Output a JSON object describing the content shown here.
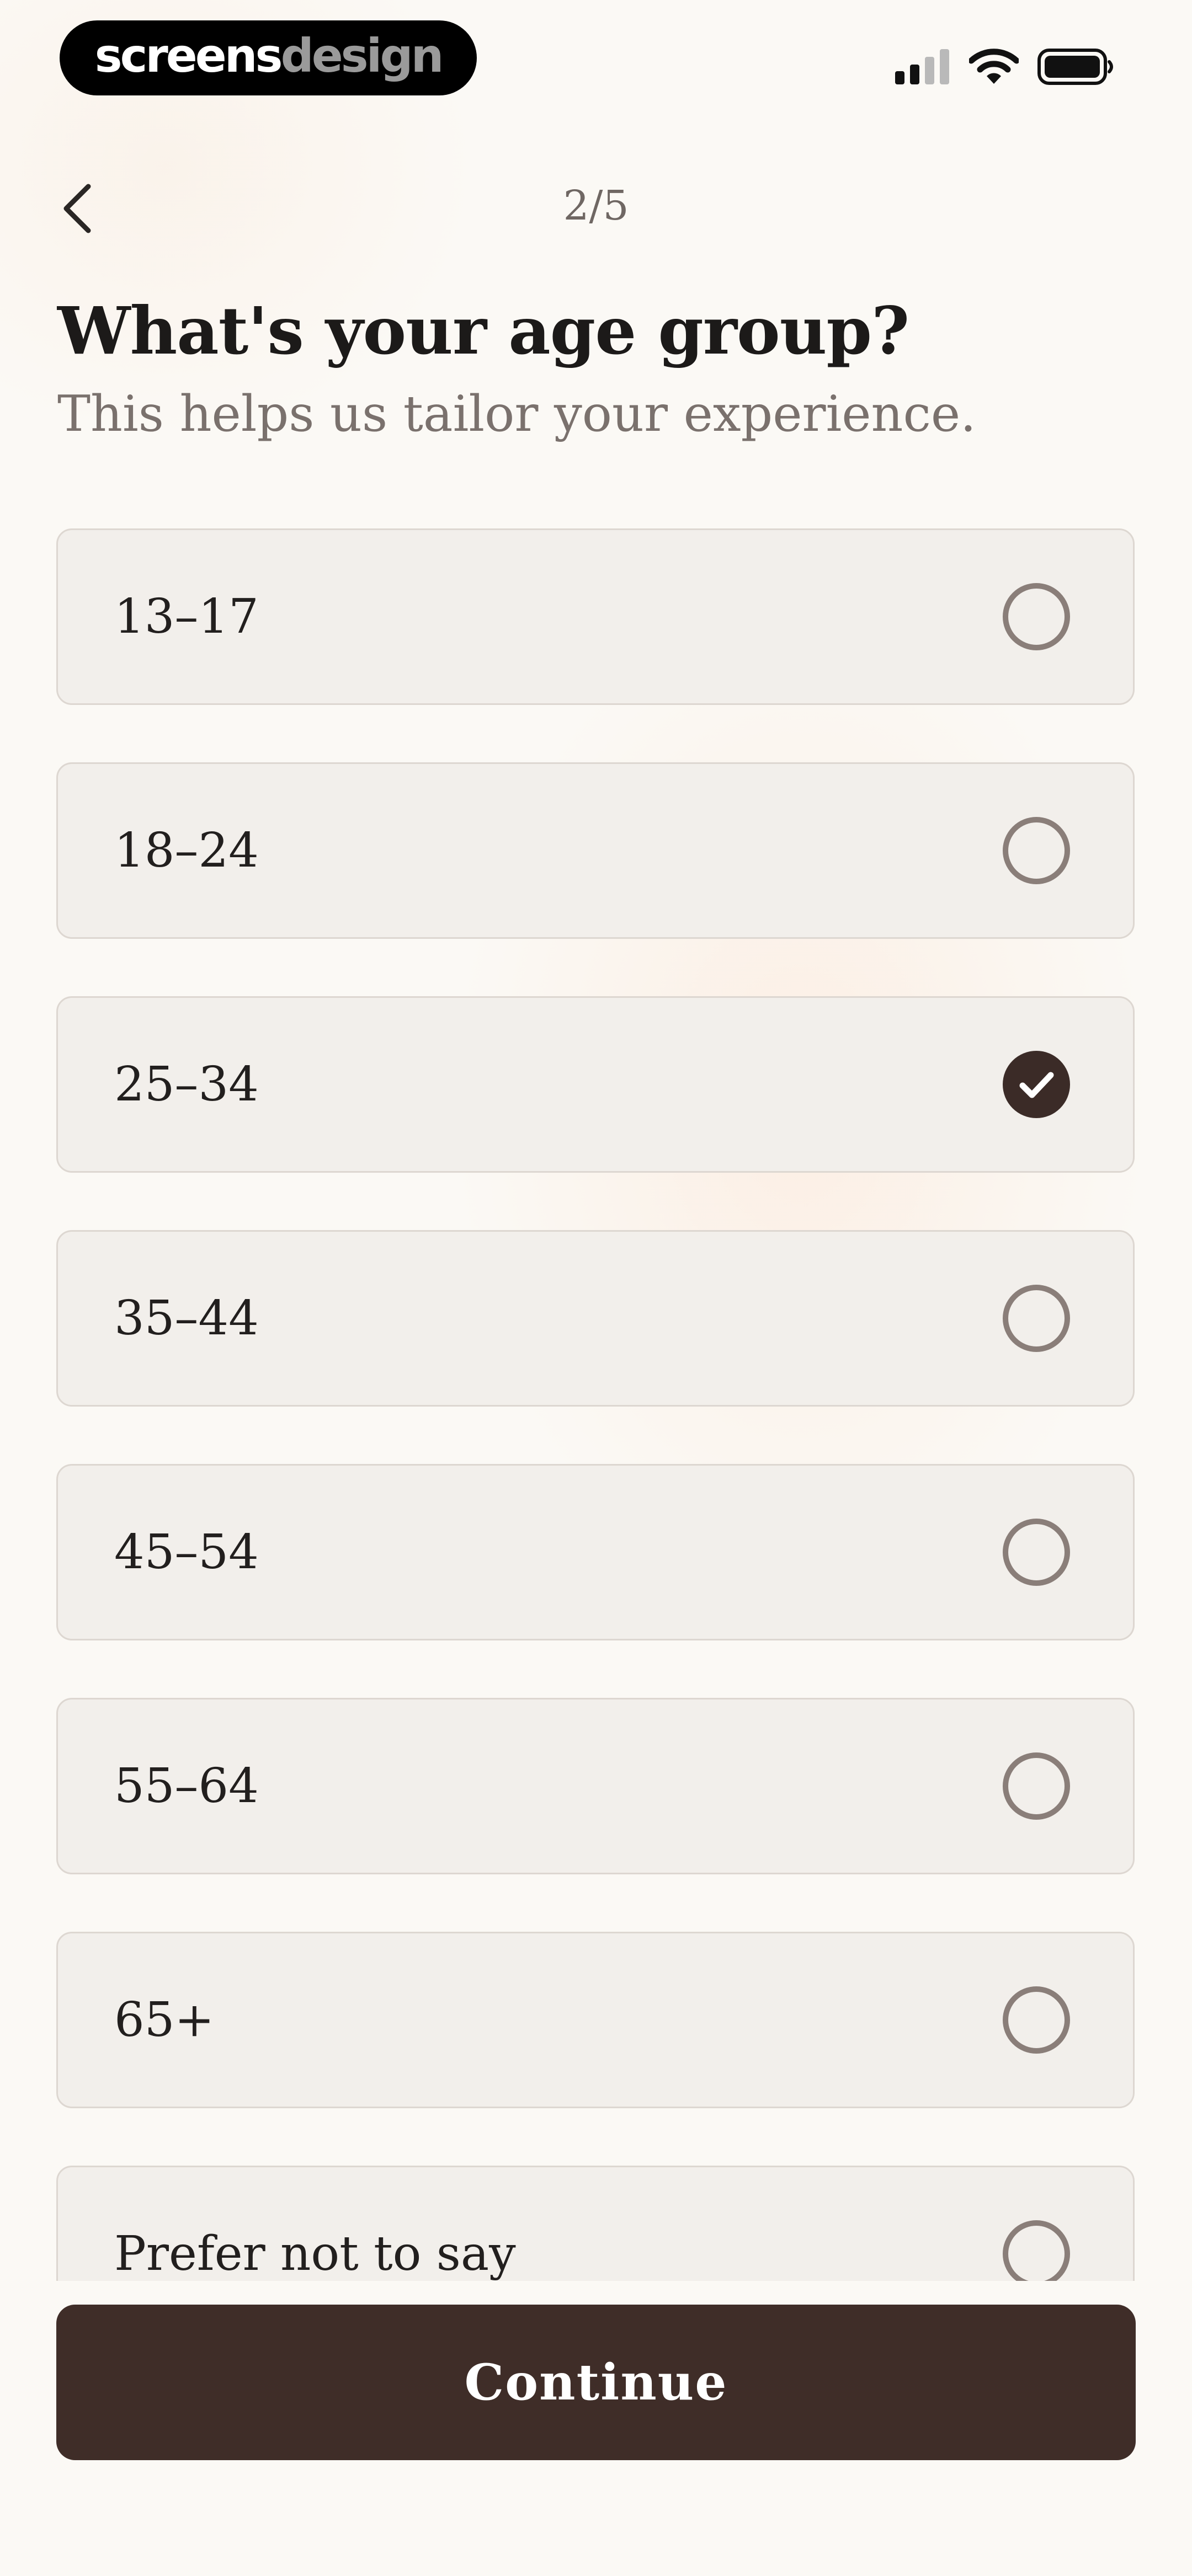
{
  "watermark": {
    "text_primary": "screens",
    "text_secondary": "design"
  },
  "status_bar": {
    "signal_icon": "cellular-signal-icon",
    "wifi_icon": "wifi-icon",
    "battery_icon": "battery-icon"
  },
  "header": {
    "back_icon": "chevron-left-icon",
    "step": "2/5"
  },
  "question": {
    "title": "What's your age group?",
    "subtitle": "This helps us tailor your experience."
  },
  "options": [
    {
      "label": "13–17",
      "selected": false
    },
    {
      "label": "18–24",
      "selected": false
    },
    {
      "label": "25–34",
      "selected": true
    },
    {
      "label": "35–44",
      "selected": false
    },
    {
      "label": "45–54",
      "selected": false
    },
    {
      "label": "55–64",
      "selected": false
    },
    {
      "label": "65+",
      "selected": false
    },
    {
      "label": "Prefer not to say",
      "selected": false
    }
  ],
  "footer": {
    "continue_label": "Continue"
  },
  "colors": {
    "background": "#fbf9f5",
    "card_background": "#f2efeb",
    "card_border": "#ddd7d1",
    "accent_dark_brown": "#3f2d28",
    "radio_unselected": "#8a7e79",
    "text_primary": "#1c1a19",
    "text_secondary": "#7a716d"
  }
}
